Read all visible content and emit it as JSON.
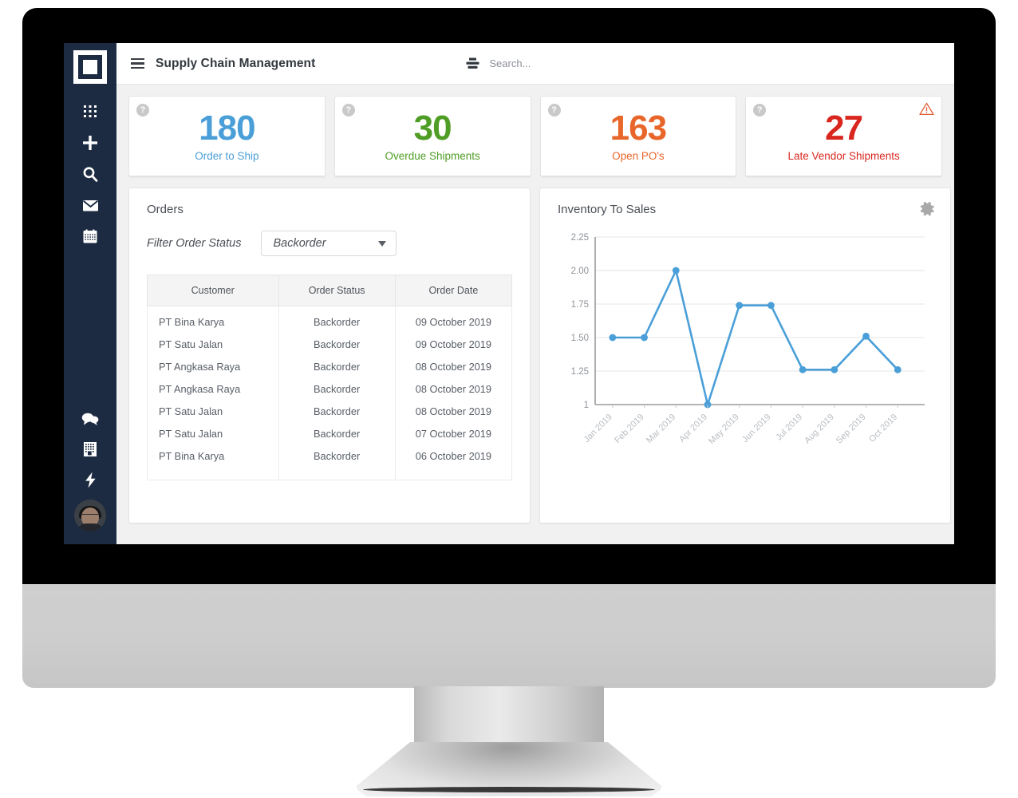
{
  "app": {
    "title": "Supply Chain Management",
    "menu_icon": "hamburger-icon",
    "logo_icon": "brand-logo-icon"
  },
  "search": {
    "placeholder": "Search...",
    "icon": "filter-sliders-icon"
  },
  "sidebar": {
    "items": [
      {
        "name": "apps-grid",
        "icon": "grid-dots-icon"
      },
      {
        "name": "add",
        "icon": "plus-icon"
      },
      {
        "name": "search",
        "icon": "magnifier-icon"
      },
      {
        "name": "mail",
        "icon": "envelope-icon"
      },
      {
        "name": "calendar",
        "icon": "calendar-icon"
      }
    ],
    "bottom_items": [
      {
        "name": "messages",
        "icon": "chat-bubbles-icon"
      },
      {
        "name": "company",
        "icon": "building-icon"
      },
      {
        "name": "activity",
        "icon": "lightning-bolt-icon"
      }
    ],
    "avatar": {
      "name": "user-avatar",
      "icon": "avatar-icon"
    }
  },
  "kpis": [
    {
      "value": "180",
      "label": "Order to Ship",
      "color": "#4a9fd8",
      "help": "?",
      "alert": false
    },
    {
      "value": "30",
      "label": "Overdue Shipments",
      "color": "#4f9d25",
      "help": "?",
      "alert": false
    },
    {
      "value": "163",
      "label": "Open PO's",
      "color": "#e8662a",
      "help": "?",
      "alert": false
    },
    {
      "value": "27",
      "label": "Late Vendor Shipments",
      "color": "#d9271f",
      "help": "?",
      "alert": true
    }
  ],
  "orders_panel": {
    "title": "Orders",
    "filter_label": "Filter Order Status",
    "filter_value": "Backorder",
    "filter_options": [
      "Backorder"
    ],
    "columns": [
      "Customer",
      "Order Status",
      "Order Date"
    ],
    "rows": [
      {
        "customer": "PT Bina Karya",
        "status": "Backorder",
        "date": "09 October 2019"
      },
      {
        "customer": "PT Satu Jalan",
        "status": "Backorder",
        "date": "09 October 2019"
      },
      {
        "customer": "PT Angkasa Raya",
        "status": "Backorder",
        "date": "08 October 2019"
      },
      {
        "customer": "PT Angkasa Raya",
        "status": "Backorder",
        "date": "08 October 2019"
      },
      {
        "customer": "PT Satu Jalan",
        "status": "Backorder",
        "date": "08 October 2019"
      },
      {
        "customer": "PT Satu Jalan",
        "status": "Backorder",
        "date": "07 October 2019"
      },
      {
        "customer": "PT Bina Karya",
        "status": "Backorder",
        "date": "06 October 2019"
      }
    ]
  },
  "chart_panel": {
    "title": "Inventory To Sales",
    "settings_icon": "gear-icon"
  },
  "chart_data": {
    "type": "line",
    "title": "Inventory To Sales",
    "xlabel": "",
    "ylabel": "",
    "x": [
      "Jan 2019",
      "Feb 2019",
      "Mar 2019",
      "Apr 2019",
      "May 2019",
      "Jun 2019",
      "Jul 2019",
      "Aug 2019",
      "Sep 2019",
      "Oct 2019"
    ],
    "values": [
      1.5,
      1.5,
      2.0,
      1.0,
      1.74,
      1.74,
      1.26,
      1.26,
      1.51,
      1.26
    ],
    "series": [
      {
        "name": "Inventory To Sales",
        "values": [
          1.5,
          1.5,
          2.0,
          1.0,
          1.74,
          1.74,
          1.26,
          1.26,
          1.51,
          1.26
        ]
      }
    ],
    "yticks": [
      "1",
      "1.25",
      "1.50",
      "1.75",
      "2.00",
      "2.25"
    ],
    "ytick_values": [
      1,
      1.25,
      1.5,
      1.75,
      2.0,
      2.25
    ],
    "ylim": [
      1,
      2.25
    ],
    "grid": true,
    "legend": "none",
    "line_color": "#4a9fd8",
    "marker_color": "#4a9fd8"
  },
  "colors": {
    "sidebar": "#1d2b42",
    "accent_blue": "#4a9fd8",
    "accent_green": "#4f9d25",
    "accent_orange": "#e8662a",
    "accent_red": "#d9271f",
    "background": "#f1f1f1"
  }
}
